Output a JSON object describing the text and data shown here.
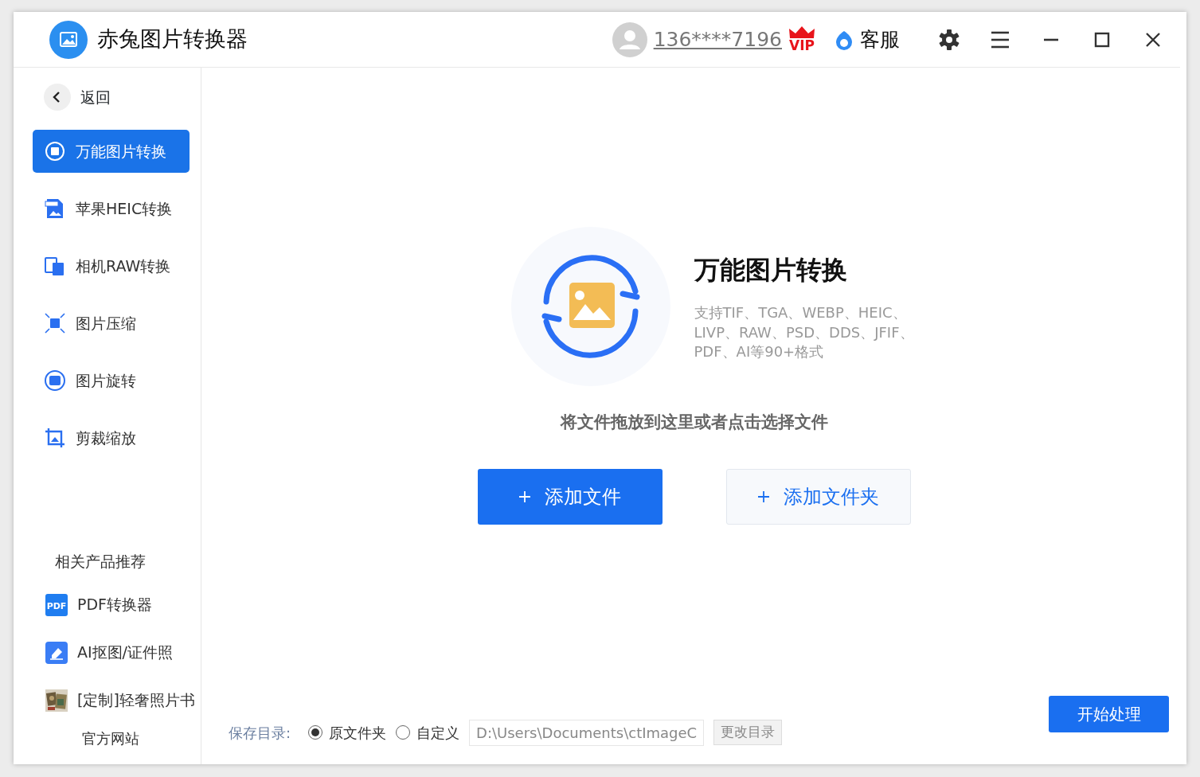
{
  "window": {
    "title": "赤兔图片转换器"
  },
  "header": {
    "account": "136****7196",
    "vip_badge": "VIP",
    "support": "客服"
  },
  "sidebar": {
    "back": "返回",
    "items": [
      {
        "label": "万能图片转换",
        "selected": true
      },
      {
        "label": "苹果HEIC转换",
        "selected": false
      },
      {
        "label": "相机RAW转换",
        "selected": false
      },
      {
        "label": "图片压缩",
        "selected": false
      },
      {
        "label": "图片旋转",
        "selected": false
      },
      {
        "label": "剪裁缩放",
        "selected": false
      }
    ],
    "recommend_title": "相关产品推荐",
    "products": [
      {
        "label": "PDF转换器",
        "kind": "pdf",
        "icon_text": "PDF"
      },
      {
        "label": "AI抠图/证件照",
        "kind": "eraser"
      },
      {
        "label": "[定制]轻奢照片书",
        "kind": "picture"
      }
    ],
    "website": "官方网站"
  },
  "main": {
    "title": "万能图片转换",
    "formats": "支持TIF、TGA、WEBP、HEIC、LIVP、RAW、PSD、DDS、JFIF、PDF、AI等90+格式",
    "hint": "将文件拖放到这里或者点击选择文件",
    "add_file": "添加文件",
    "add_folder": "添加文件夹"
  },
  "footer": {
    "save_label": "保存目录:",
    "options": [
      {
        "label": "原文件夹",
        "selected": true
      },
      {
        "label": "自定义",
        "selected": false
      }
    ],
    "path": "D:\\Users\\Documents\\ctImageC",
    "change": "更改目录",
    "start": "开始处理"
  }
}
